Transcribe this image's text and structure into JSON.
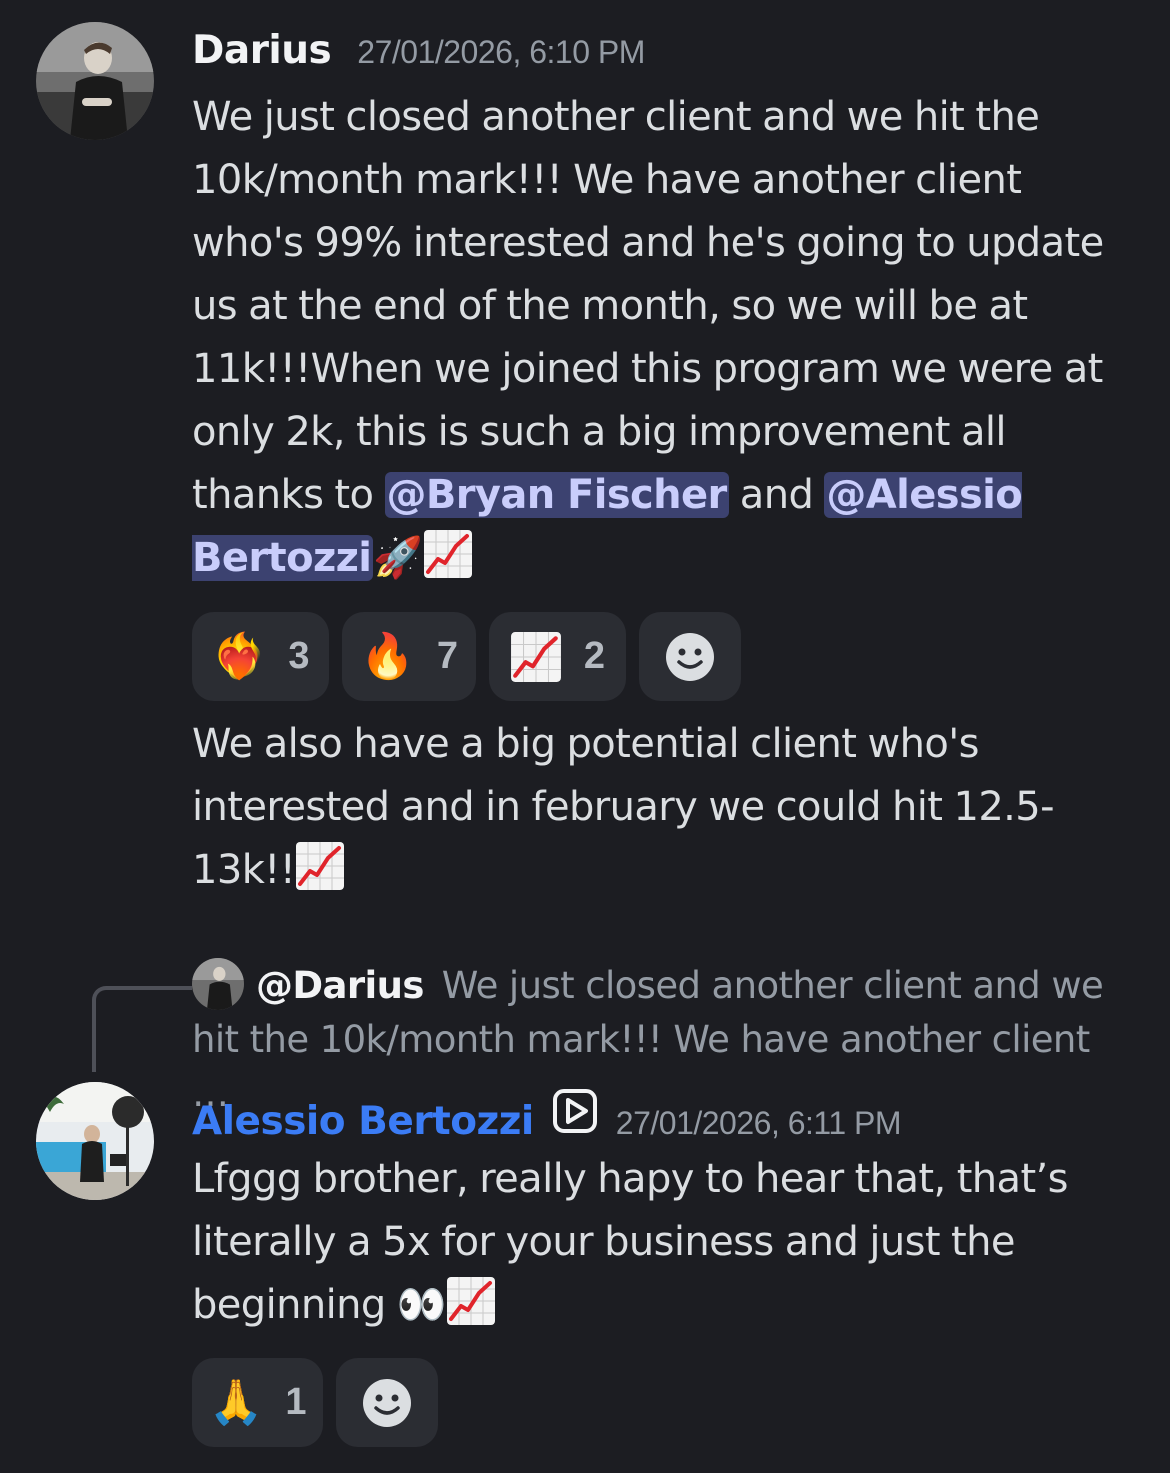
{
  "messages": [
    {
      "author": "Darius",
      "timestamp": "27/01/2026, 6:10 PM",
      "text_part1": "We just closed another client and we hit the 10k/month mark!!! We have another client who's 99% interested and he's going to update us at the end of the month, so we will be at 11k!!!When we joined this program we were at only 2k, this is such a big improvement all thanks to ",
      "mention1": "@Bryan Fischer",
      "text_part2": " and ",
      "mention2": "@Alessio Bertozzi",
      "emoji1": "🚀",
      "reactions": [
        {
          "emoji": "❤️‍🔥",
          "count": "3"
        },
        {
          "emoji": "🔥",
          "count": "7"
        },
        {
          "emoji": "chart-increasing",
          "count": "2"
        }
      ],
      "followup": "We also have a big potential client who's interested and in february we could hit 12.5-13k!!"
    },
    {
      "reply_to_author": "@Darius",
      "reply_preview": "We just closed another client and we hit the 10k/month mark!!! We have another client …",
      "author": "Alessio Bertozzi",
      "timestamp": "27/01/2026, 6:11 PM",
      "text": "Lfggg brother, really hapy to hear that, that’s literally a 5x for your business and just the beginning ",
      "emoji_eyes": "👀",
      "reactions": [
        {
          "emoji": "🙏",
          "count": "1"
        }
      ]
    }
  ],
  "icons": {
    "add_reaction": "smiley-add-reaction-icon",
    "app_badge": "play-app-badge-icon",
    "chart": "chart-increasing-emoji"
  },
  "colors": {
    "background": "#1c1d22",
    "mention_bg": "#3c4270",
    "author_blue": "#3b7cf5",
    "reaction_bg": "#2b2d33"
  }
}
